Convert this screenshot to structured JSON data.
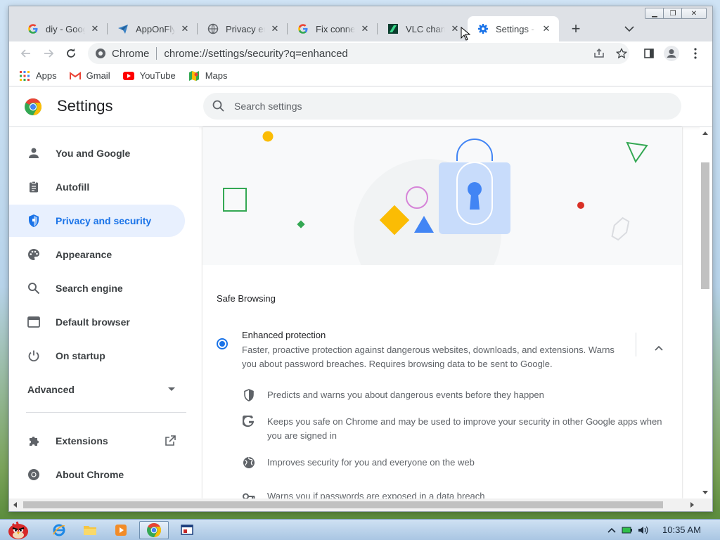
{
  "tabs": [
    {
      "label": "diy - Google",
      "icon": "google-g-icon"
    },
    {
      "label": "AppOnFly",
      "icon": "paper-plane-icon"
    },
    {
      "label": "Privacy error",
      "icon": "globe-icon"
    },
    {
      "label": "Fix connection",
      "icon": "google-g-icon"
    },
    {
      "label": "VLC chan b",
      "icon": "vlc-site-icon"
    },
    {
      "label": "Settings - S",
      "icon": "gear-icon",
      "active": true
    }
  ],
  "toolbar": {
    "site_name": "Chrome",
    "url": "chrome://settings/security?q=enhanced"
  },
  "bookmarks": [
    {
      "label": "Apps",
      "icon": "apps-grid-icon"
    },
    {
      "label": "Gmail",
      "icon": "gmail-icon"
    },
    {
      "label": "YouTube",
      "icon": "youtube-icon"
    },
    {
      "label": "Maps",
      "icon": "maps-icon"
    }
  ],
  "settings": {
    "title": "Settings",
    "search_placeholder": "Search settings"
  },
  "sidebar": {
    "items": [
      {
        "label": "You and Google",
        "icon": "person-icon"
      },
      {
        "label": "Autofill",
        "icon": "clipboard-icon"
      },
      {
        "label": "Privacy and security",
        "icon": "shield-icon",
        "active": true
      },
      {
        "label": "Appearance",
        "icon": "palette-icon"
      },
      {
        "label": "Search engine",
        "icon": "search-icon"
      },
      {
        "label": "Default browser",
        "icon": "browser-window-icon"
      },
      {
        "label": "On startup",
        "icon": "power-icon"
      }
    ],
    "advanced_label": "Advanced",
    "extensions_label": "Extensions",
    "about_label": "About Chrome"
  },
  "content": {
    "section_title": "Safe Browsing",
    "enhanced_title": "Enhanced protection",
    "enhanced_desc": "Faster, proactive protection against dangerous websites, downloads, and extensions. Warns you about password breaches. Requires browsing data to be sent to Google.",
    "features": [
      {
        "text": "Predicts and warns you about dangerous events before they happen",
        "icon": "shield-half-icon"
      },
      {
        "text": "Keeps you safe on Chrome and may be used to improve your security in other Google apps when you are signed in",
        "icon": "google-g-icon"
      },
      {
        "text": "Improves security for you and everyone on the web",
        "icon": "globe-icon"
      },
      {
        "text": "Warns you if passwords are exposed in a data breach",
        "icon": "key-icon"
      }
    ]
  },
  "taskbar": {
    "clock": "10:35 AM"
  },
  "colors": {
    "accent": "#1a73e8",
    "active_bg": "#e8f0fe"
  }
}
